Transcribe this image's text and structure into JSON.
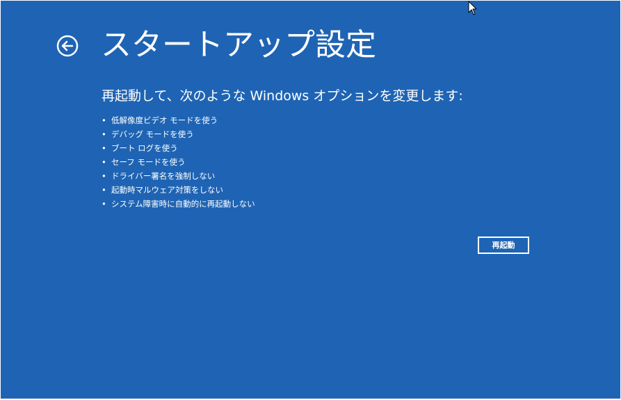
{
  "header": {
    "title": "スタートアップ設定",
    "back_icon": "back-arrow-icon"
  },
  "main": {
    "subtitle": "再起動して、次のような Windows オプションを変更します:",
    "bullet": "•",
    "options": [
      "低解像度ビデオ モードを使う",
      "デバッグ モードを使う",
      "ブート ログを使う",
      "セーフ モードを使う",
      "ドライバー署名を強制しない",
      "起動時マルウェア対策をしない",
      "システム障害時に自動的に再起動しない"
    ],
    "restart_label": "再起動"
  },
  "colors": {
    "background": "#1f64b4",
    "foreground": "#ffffff"
  },
  "cursor_icon": "mouse-pointer-icon"
}
